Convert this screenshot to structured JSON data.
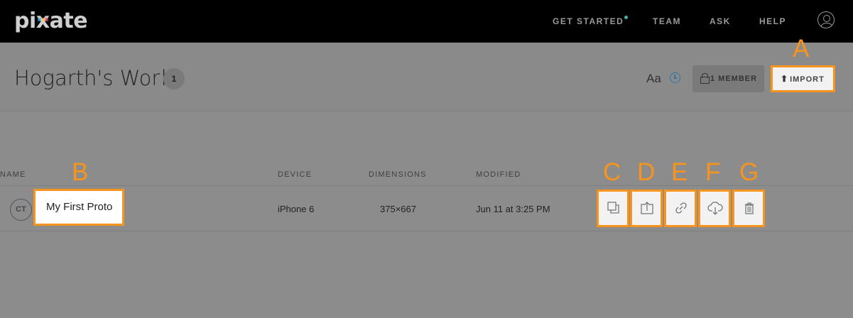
{
  "brand": {
    "name_pre": "pi",
    "name_x": "x",
    "name_post": "ate"
  },
  "nav": {
    "items": [
      "GET STARTED",
      "TEAM",
      "ASK",
      "HELP"
    ]
  },
  "header": {
    "title": "Hogarth's Work",
    "count": "1",
    "font_toggle": "Aa",
    "member_button": "1 MEMBER",
    "import_button": "IMPORT"
  },
  "table": {
    "columns": [
      "NAME",
      "DEVICE",
      "DIMENSIONS",
      "MODIFIED"
    ],
    "rows": [
      {
        "owner_initials": "CT",
        "name": "My First Proto",
        "device": "iPhone 6",
        "dimensions": "375×667",
        "modified": "Jun 11 at 3:25 PM"
      }
    ],
    "actions": [
      {
        "icon": "duplicate-icon"
      },
      {
        "icon": "share-icon"
      },
      {
        "icon": "link-icon"
      },
      {
        "icon": "download-icon"
      },
      {
        "icon": "trash-icon"
      }
    ]
  },
  "annotations": [
    "A",
    "B",
    "C",
    "D",
    "E",
    "F",
    "G"
  ],
  "colors": {
    "accent": "#f7941d",
    "nav_dot": "#3fb3a5",
    "clock": "#2b77a8",
    "topbar": "#000000",
    "overlay": "#8c8c8c"
  }
}
